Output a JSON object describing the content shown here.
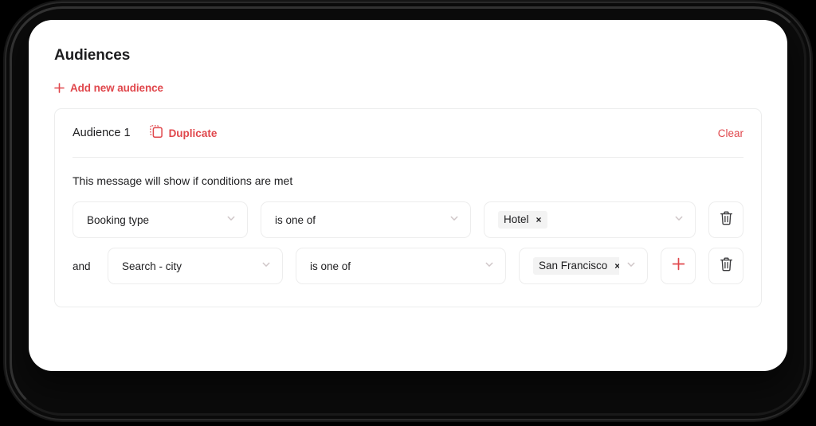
{
  "page": {
    "title": "Audiences",
    "add_new_label": "Add new audience"
  },
  "colors": {
    "accent_red": "#e0474c",
    "text_primary": "#1d1d1f",
    "border": "#ededed",
    "chip_bg": "#f3f3f3",
    "card_bg": "#ffffff",
    "backdrop": "#000000"
  },
  "audience": {
    "name": "Audience 1",
    "duplicate_label": "Duplicate",
    "clear_label": "Clear",
    "conditions_caption": "This message will show if conditions are met",
    "rows": [
      {
        "conjunction": "",
        "field": "Booking type",
        "operator": "is one of",
        "values": [
          "Hotel"
        ],
        "has_add_button": false,
        "has_delete_button": true
      },
      {
        "conjunction": "and",
        "field": "Search - city",
        "operator": "is one of",
        "values": [
          "San Francisco"
        ],
        "has_add_button": true,
        "has_delete_button": true
      }
    ]
  },
  "icons": {
    "plus": "plus-icon",
    "duplicate": "duplicate-icon",
    "chevron_down": "chevron-down-icon",
    "trash": "trash-icon",
    "chip_remove": "×"
  }
}
